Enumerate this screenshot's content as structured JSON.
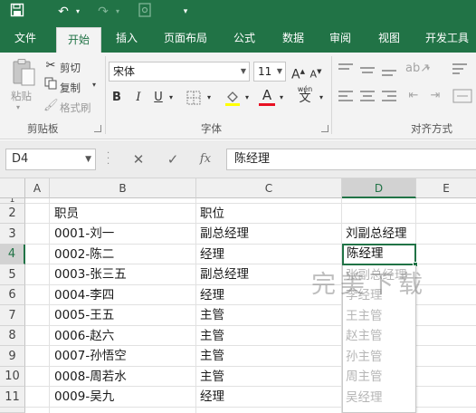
{
  "qat": {
    "save_icon": "save-icon",
    "undo_icon": "undo-icon",
    "redo_icon": "redo-icon",
    "touch_mode_icon": "touch-mode-icon",
    "customize_icon": "customize-qat-icon"
  },
  "ribbon_tabs": [
    "文件",
    "开始",
    "插入",
    "页面布局",
    "公式",
    "数据",
    "审阅",
    "视图",
    "开发工具"
  ],
  "active_tab": "开始",
  "clipboard": {
    "paste_label": "粘贴",
    "cut_label": "剪切",
    "copy_label": "复制",
    "format_painter_label": "格式刷",
    "group_label": "剪贴板"
  },
  "font": {
    "font_name": "宋体",
    "font_size": "11",
    "increase_label": "A",
    "decrease_label": "A",
    "bold_label": "B",
    "italic_label": "I",
    "underline_label": "U",
    "font_color_label": "A",
    "phonetic_label": "wén",
    "group_label": "字体",
    "accent_color": "#e81123"
  },
  "alignment": {
    "group_label": "对齐方式"
  },
  "formula_bar": {
    "name_box": "D4",
    "cancel_label": "✕",
    "enter_label": "✓",
    "fx_label": "fx",
    "formula": "陈经理"
  },
  "sheet": {
    "columns": [
      "A",
      "B",
      "C",
      "D",
      "E"
    ],
    "selected_column": "D",
    "rows": [
      {
        "num": "1",
        "b": "",
        "c": "",
        "d": ""
      },
      {
        "num": "2",
        "b": "职员",
        "c": "职位",
        "d": ""
      },
      {
        "num": "3",
        "b": "0001-刘一",
        "c": "副总经理",
        "d": "刘副总经理"
      },
      {
        "num": "4",
        "b": "0002-陈二",
        "c": "经理",
        "d": ""
      },
      {
        "num": "5",
        "b": "0003-张三五",
        "c": "副总经理",
        "d": ""
      },
      {
        "num": "6",
        "b": "0004-李四",
        "c": "经理",
        "d": ""
      },
      {
        "num": "7",
        "b": "0005-王五",
        "c": "主管",
        "d": ""
      },
      {
        "num": "8",
        "b": "0006-赵六",
        "c": "主管",
        "d": ""
      },
      {
        "num": "9",
        "b": "0007-孙悟空",
        "c": "主管",
        "d": ""
      },
      {
        "num": "10",
        "b": "0008-周若水",
        "c": "主管",
        "d": ""
      },
      {
        "num": "11",
        "b": "0009-吴九",
        "c": "经理",
        "d": ""
      }
    ],
    "selected_row": "4",
    "active_cell_value": "陈经理",
    "autocomplete": [
      "张副总经理",
      "李经理",
      "王主管",
      "赵主管",
      "孙主管",
      "周主管",
      "吴经理"
    ]
  },
  "watermark": "完美下载",
  "colors": {
    "excel_green": "#217346",
    "ribbon_bg": "#f3f3f3",
    "header_bg": "#f0f0f0"
  }
}
